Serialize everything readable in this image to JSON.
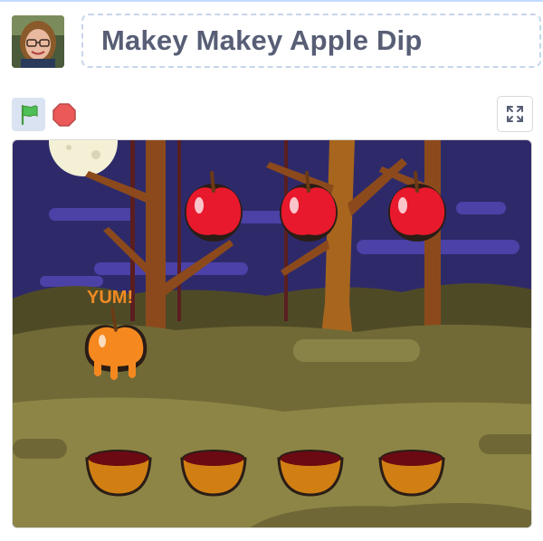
{
  "project": {
    "title": "Makey Makey Apple Dip"
  },
  "author": {
    "avatar_icon": "user-avatar"
  },
  "controls": {
    "green_flag_icon": "green-flag-icon",
    "stop_icon": "stop-sign-icon",
    "fullscreen_icon": "fullscreen-icon"
  },
  "stage": {
    "speech_text": "YUM!",
    "colors": {
      "sky": "#2e2a6a",
      "ground": "#716a36",
      "apple_red": "#e8192c",
      "apple_caramel": "#f5891f",
      "bowl": "#d17f13",
      "dip": "#6b0a12",
      "yum_text": "#f08a24"
    }
  }
}
